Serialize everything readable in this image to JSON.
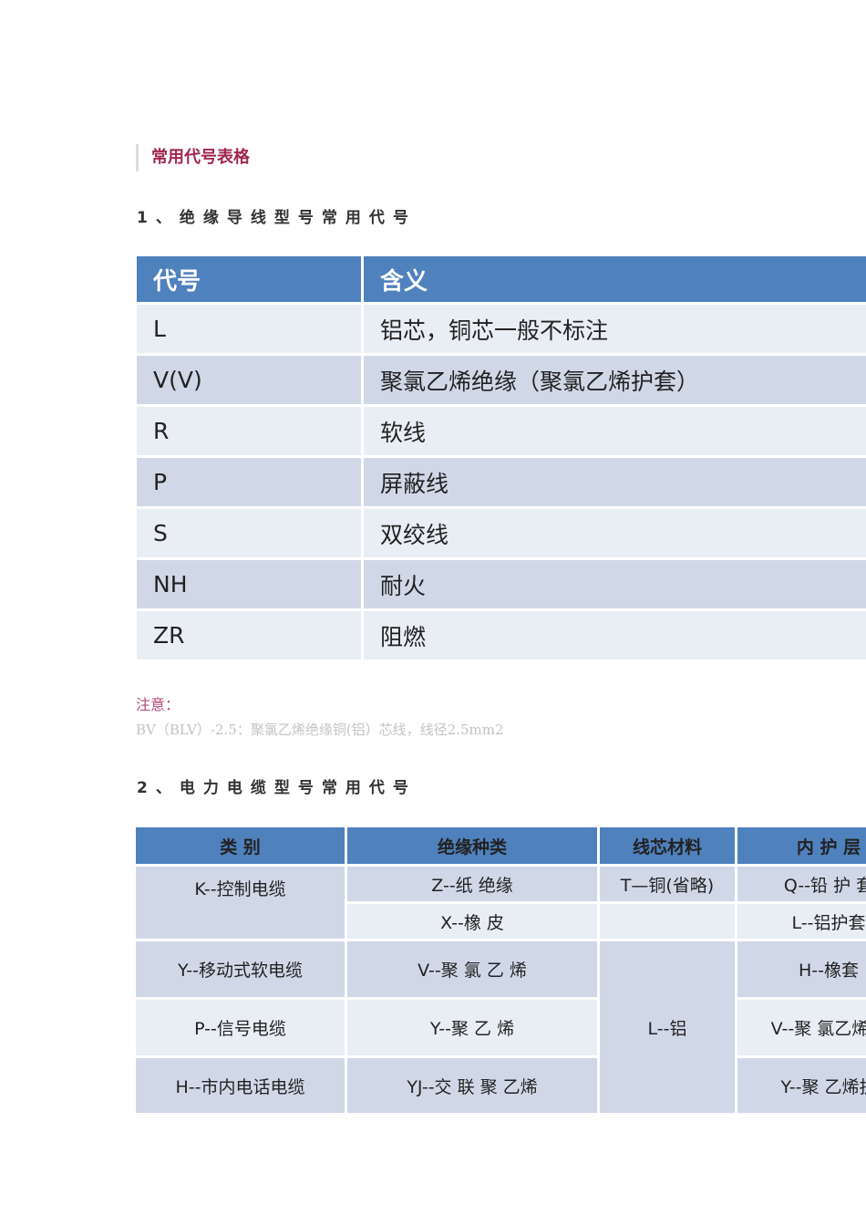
{
  "title": "常用代号表格",
  "section1": "1、绝缘导线型号常用代号",
  "table1": {
    "headers": [
      "代号",
      "含义"
    ],
    "rows": [
      [
        "L",
        "铝芯，铜芯一般不标注"
      ],
      [
        "V(V)",
        "聚氯乙烯绝缘（聚氯乙烯护套）"
      ],
      [
        "R",
        "软线"
      ],
      [
        "P",
        "屏蔽线"
      ],
      [
        "S",
        "双绞线"
      ],
      [
        "NH",
        "耐火"
      ],
      [
        "ZR",
        "阻燃"
      ]
    ]
  },
  "note_label": "注意：",
  "note_text": "BV（BLV）-2.5：聚氯乙烯绝缘铜(铝）芯线，线径2.5mm2",
  "section2": "2、电力电缆型号常用代号",
  "table2": {
    "headers": [
      "类 别",
      "绝缘种类",
      "线芯材料",
      "内 护 层"
    ],
    "category": [
      "K--控制电缆",
      "Y--移动式软电缆",
      "P--信号电缆",
      "H--市内电话电缆"
    ],
    "insulation": [
      "Z--纸 绝缘",
      "X--橡 皮",
      "V--聚 氯 乙 烯",
      "Y--聚 乙 烯",
      "YJ--交 联 聚 乙烯"
    ],
    "core": [
      "T—铜(省略)",
      "L--铝"
    ],
    "sheath": [
      "Q--铅 护 套",
      "L--铝护套",
      "H--橡套",
      "V--聚 氯乙烯护",
      "Y--聚 乙烯护"
    ]
  }
}
